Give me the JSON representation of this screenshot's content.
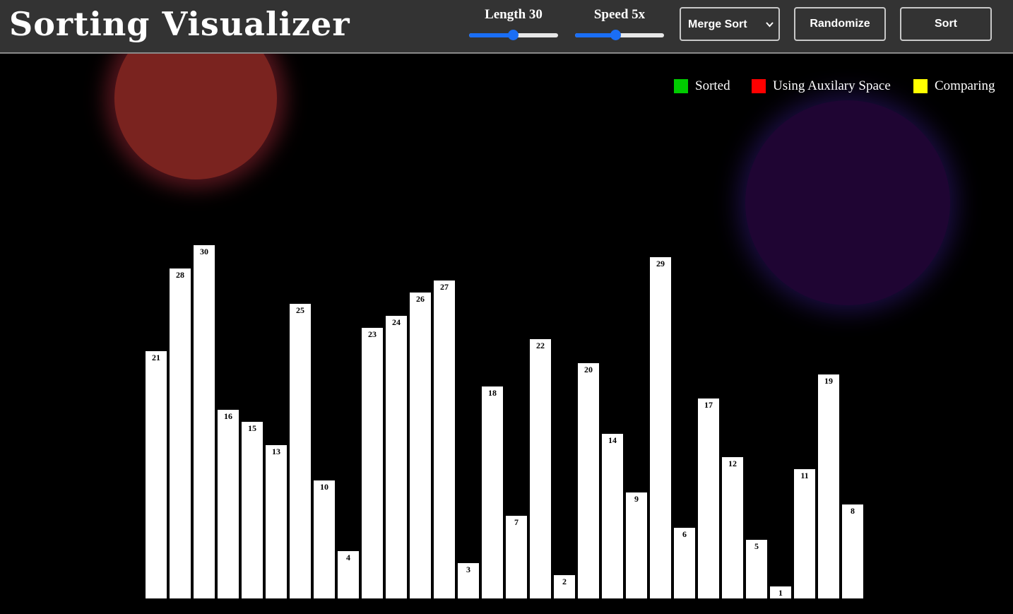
{
  "header": {
    "title": "Sorting Visualizer",
    "length": {
      "label": "Length 30",
      "value": 30,
      "fraction": 0.5
    },
    "speed": {
      "label": "Speed 5x",
      "value": 5,
      "fraction": 0.46
    },
    "algorithm": {
      "selected": "Merge Sort"
    },
    "randomize_label": "Randomize",
    "sort_label": "Sort"
  },
  "legend": [
    {
      "label": "Sorted",
      "color": "#00cc00"
    },
    {
      "label": "Using Auxilary Space",
      "color": "#ff0000"
    },
    {
      "label": "Comparing",
      "color": "#ffff00"
    }
  ],
  "bar_color": "#ffffff",
  "array": [
    21,
    28,
    30,
    16,
    15,
    13,
    25,
    10,
    4,
    23,
    24,
    26,
    27,
    3,
    18,
    7,
    22,
    2,
    20,
    14,
    9,
    29,
    6,
    17,
    12,
    5,
    1,
    11,
    19,
    8
  ]
}
